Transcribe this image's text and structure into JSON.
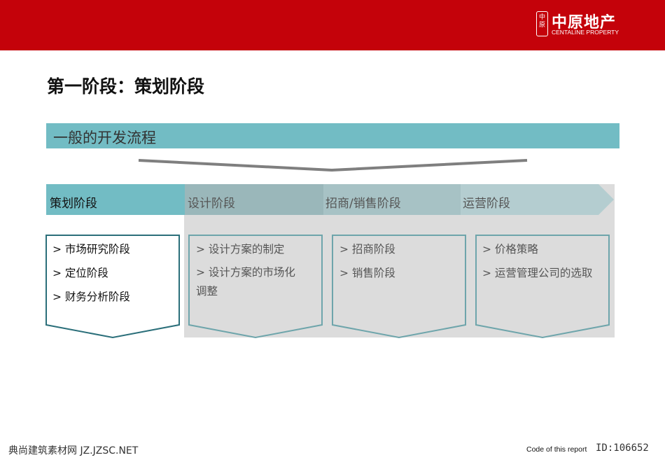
{
  "header": {
    "logo_seal": "中原",
    "logo_cn": "中原地产",
    "logo_en": "CENTALINE PROPERTY",
    "brand_color": "#c4020a"
  },
  "title": "第一阶段：策划阶段",
  "banner": {
    "text": "一般的开发流程",
    "color": "#72bcc4"
  },
  "stages": [
    {
      "label": "策划阶段",
      "items": [
        "> 市场研究阶段",
        "> 定位阶段",
        "> 财务分析阶段"
      ]
    },
    {
      "label": "设计阶段",
      "items": [
        "> 设计方案的制定",
        "> 设计方案的市场化调整"
      ]
    },
    {
      "label": "招商/销售阶段",
      "items": [
        "> 招商阶段",
        "> 销售阶段"
      ]
    },
    {
      "label": "运营阶段",
      "items": [
        "> 价格策略",
        "> 运营管理公司的选取"
      ]
    }
  ],
  "footer": {
    "watermark": "典尚建筑素材网 JZ.JZSC.NET",
    "code_label": "Code of this report",
    "id_text": "ID:106652"
  }
}
